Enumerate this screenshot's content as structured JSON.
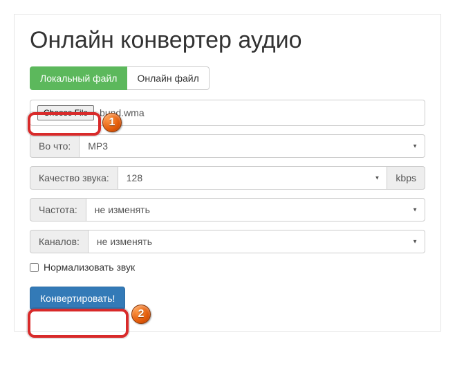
{
  "title": "Онлайн конвертер аудио",
  "tabs": {
    "local": "Локальный файл",
    "online": "Онлайн файл"
  },
  "file": {
    "button": "Choose File",
    "name": "bund.wma"
  },
  "format": {
    "label": "Во что:",
    "value": "MP3"
  },
  "quality": {
    "label": "Качество звука:",
    "value": "128",
    "unit": "kbps"
  },
  "frequency": {
    "label": "Частота:",
    "value": "не изменять"
  },
  "channels": {
    "label": "Каналов:",
    "value": "не изменять"
  },
  "normalize": {
    "label": "Нормализовать звук"
  },
  "convert": {
    "label": "Конвертировать!"
  },
  "annotations": {
    "badge1": "1",
    "badge2": "2"
  }
}
